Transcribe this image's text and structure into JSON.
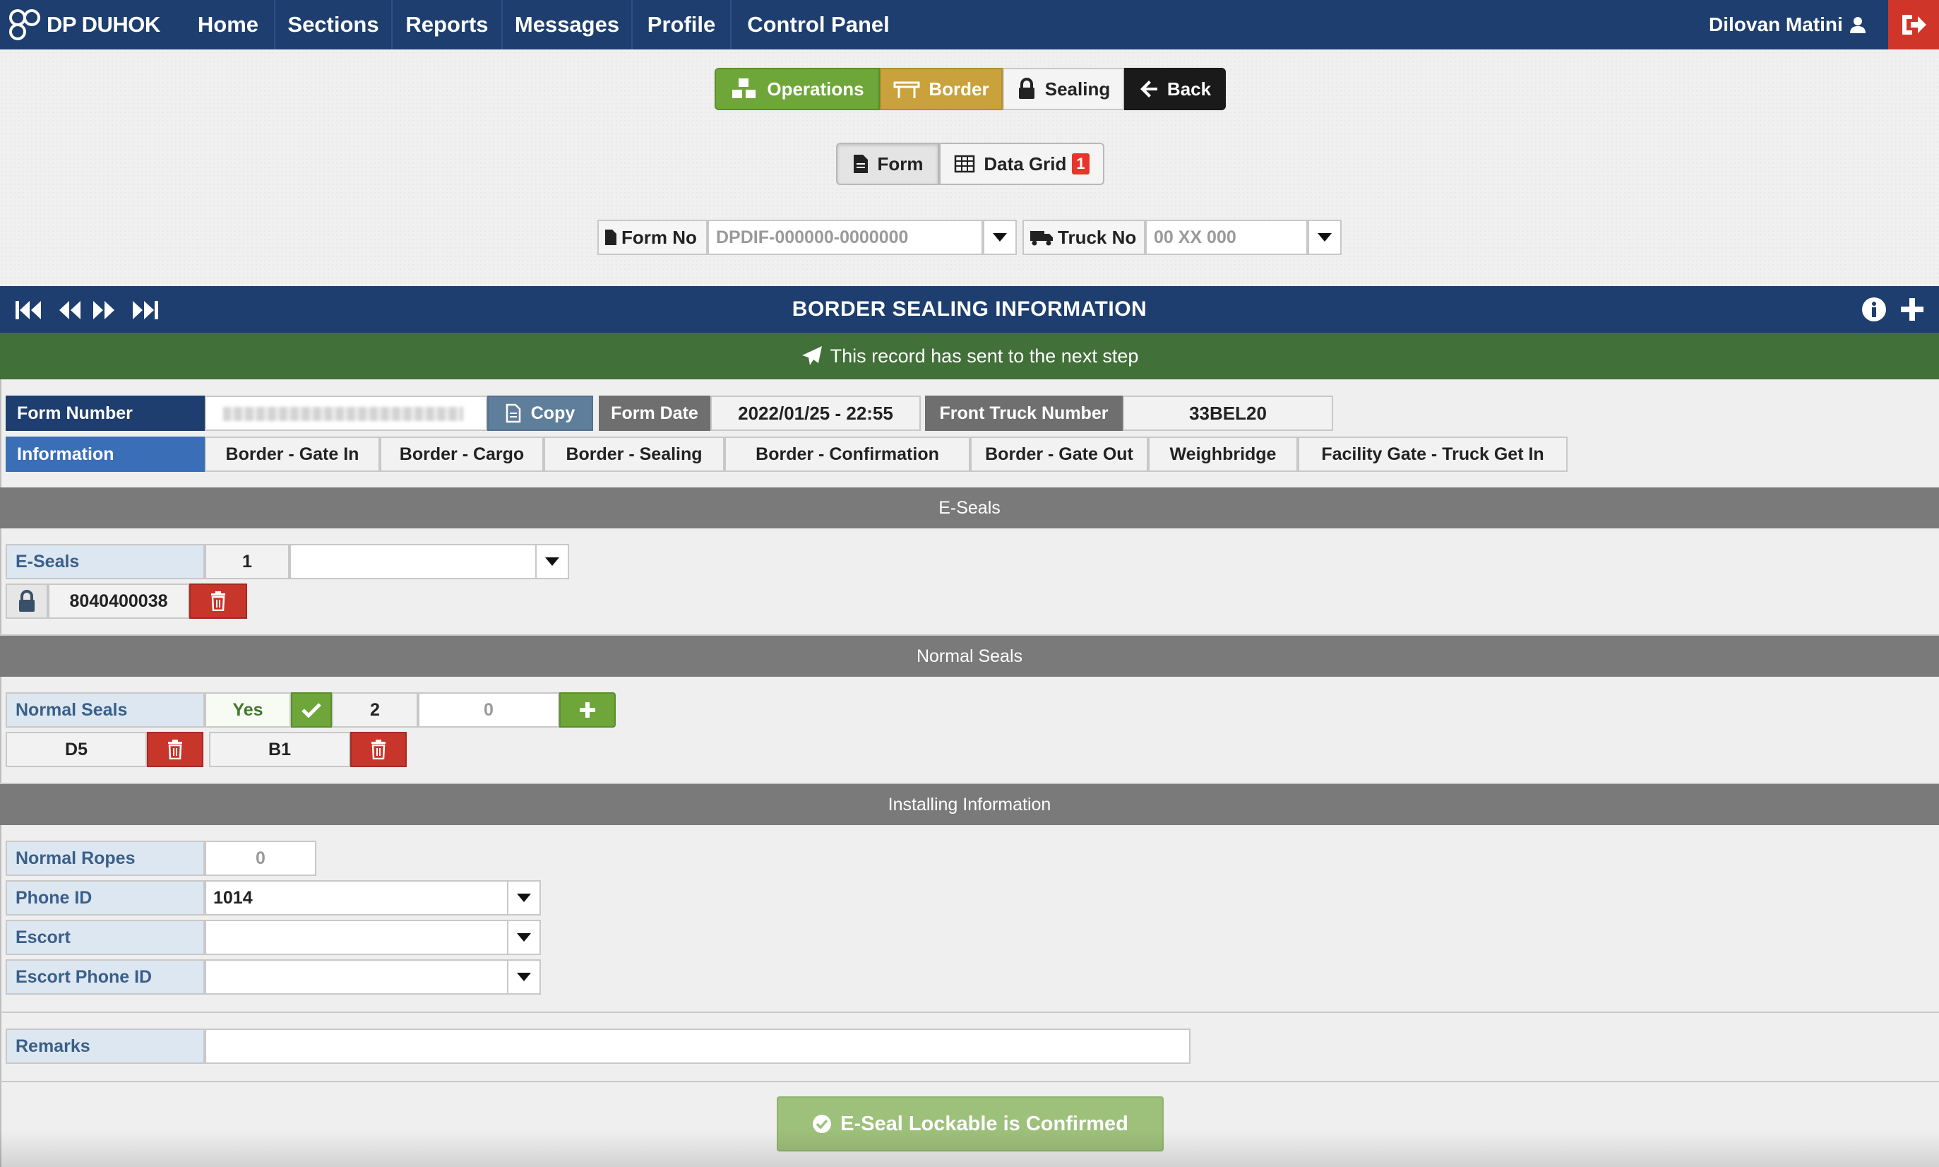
{
  "navbar": {
    "brand": "DP DUHOK",
    "items": [
      "Home",
      "Sections",
      "Reports",
      "Messages",
      "Profile",
      "Control Panel"
    ],
    "user_name": "Dilovan Matini"
  },
  "module_buttons": {
    "operations": "Operations",
    "border": "Border",
    "sealing": "Sealing",
    "back": "Back"
  },
  "view_buttons": {
    "form": "Form",
    "data_grid": "Data Grid",
    "data_grid_badge": "1"
  },
  "filters": {
    "form_no_label": "Form No",
    "form_no_placeholder": "DPDIF-000000-0000000",
    "truck_no_label": "Truck No",
    "truck_no_placeholder": "00 XX 000"
  },
  "panel": {
    "title": "BORDER SEALING INFORMATION",
    "status_message": "This record has sent to the next step"
  },
  "record": {
    "form_number_label": "Form Number",
    "copy_label": "Copy",
    "form_date_label": "Form Date",
    "form_date_value": "2022/01/25 - 22:55",
    "front_truck_label": "Front Truck Number",
    "front_truck_value": "33BEL20"
  },
  "tabs": [
    "Information",
    "Border - Gate In",
    "Border - Cargo",
    "Border - Sealing",
    "Border - Confirmation",
    "Border - Gate Out",
    "Weighbridge",
    "Facility Gate - Truck Get In"
  ],
  "eseals": {
    "section_title": "E-Seals",
    "label": "E-Seals",
    "count": "1",
    "seal_number": "8040400038"
  },
  "normal_seals": {
    "section_title": "Normal Seals",
    "label": "Normal Seals",
    "enabled": "Yes",
    "count": "2",
    "new_value": "0",
    "seals": [
      "D5",
      "B1"
    ]
  },
  "installing": {
    "section_title": "Installing Information",
    "normal_ropes_label": "Normal Ropes",
    "normal_ropes_value": "0",
    "phone_id_label": "Phone ID",
    "phone_id_value": "1014",
    "escort_label": "Escort",
    "escort_value": "",
    "escort_phone_label": "Escort Phone ID",
    "escort_phone_value": ""
  },
  "remarks": {
    "label": "Remarks",
    "value": ""
  },
  "confirm_button": "E-Seal Lockable is Confirmed",
  "colors": {
    "navbar": "#1d3e6e",
    "operations": "#6ea63a",
    "border": "#c9a13d",
    "success": "#417038",
    "danger": "#c8352b",
    "confirm": "#9dc07a"
  }
}
